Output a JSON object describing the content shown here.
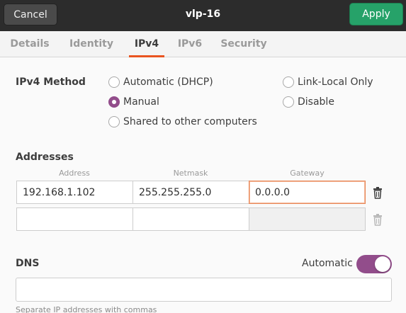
{
  "header": {
    "cancel_label": "Cancel",
    "title": "vlp-16",
    "apply_label": "Apply"
  },
  "tabs": [
    {
      "label": "Details",
      "active": false
    },
    {
      "label": "Identity",
      "active": false
    },
    {
      "label": "IPv4",
      "active": true
    },
    {
      "label": "IPv6",
      "active": false
    },
    {
      "label": "Security",
      "active": false
    }
  ],
  "ipv4_method": {
    "label": "IPv4 Method",
    "options": [
      {
        "label": "Automatic (DHCP)",
        "checked": false
      },
      {
        "label": "Manual",
        "checked": true
      },
      {
        "label": "Shared to other computers",
        "checked": false
      },
      {
        "label": "Link-Local Only",
        "checked": false
      },
      {
        "label": "Disable",
        "checked": false
      }
    ]
  },
  "addresses": {
    "label": "Addresses",
    "columns": [
      "Address",
      "Netmask",
      "Gateway"
    ],
    "rows": [
      {
        "address": "192.168.1.102",
        "netmask": "255.255.255.0",
        "gateway": "0.0.0.0"
      },
      {
        "address": "",
        "netmask": "",
        "gateway": ""
      }
    ]
  },
  "dns": {
    "label": "DNS",
    "automatic_label": "Automatic",
    "automatic_on": true,
    "value": "",
    "hint": "Separate IP addresses with commas"
  },
  "colors": {
    "accent": "#e95420",
    "apply": "#26a269",
    "toggle": "#924d8b",
    "radio": "#924d8b"
  }
}
